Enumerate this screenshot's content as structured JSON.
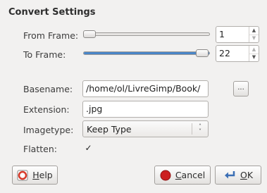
{
  "dialog": {
    "section_title": "Convert Settings"
  },
  "from_frame": {
    "label": "From Frame:",
    "value": "1",
    "slider_fraction": 0.0
  },
  "to_frame": {
    "label": "To Frame:",
    "value": "22",
    "slider_fraction": 1.0
  },
  "basename": {
    "label": "Basename:",
    "value": "/home/ol/LivreGimp/Book/",
    "browse_label": "..."
  },
  "extension": {
    "label": "Extension:",
    "value": ".jpg"
  },
  "imagetype": {
    "label": "Imagetype:",
    "selected": "Keep Type"
  },
  "flatten": {
    "label": "Flatten:",
    "checked": true,
    "check_glyph": "✓"
  },
  "buttons": {
    "help": {
      "mnemonic": "H",
      "rest": "elp",
      "icon": "help-icon"
    },
    "cancel": {
      "mnemonic": "C",
      "rest": "ancel",
      "icon": "cancel-icon"
    },
    "ok": {
      "mnemonic": "O",
      "rest": "K",
      "icon": "ok-arrow-icon"
    }
  },
  "colors": {
    "slider_fill": "#4a86c8",
    "cancel_icon": "#cc1f1f",
    "help_icon": "#d83a2a"
  }
}
